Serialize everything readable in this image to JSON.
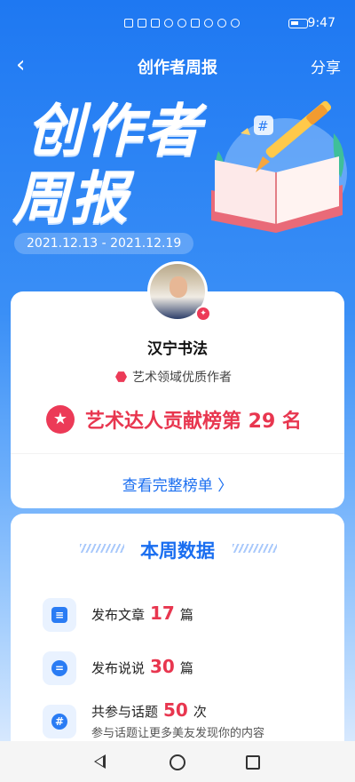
{
  "status": {
    "time": "9:47"
  },
  "nav": {
    "title": "创作者周报",
    "share": "分享",
    "back_glyph": "‹"
  },
  "hero": {
    "line1": "创作者",
    "line2": "周报",
    "date_range": "2021.12.13 - 2021.12.19"
  },
  "author": {
    "name": "汉宁书法",
    "quality_label": "艺术领域优质作者"
  },
  "rank": {
    "text": "艺术达人贡献榜第 29 名"
  },
  "full_list_link": "查看完整榜单 〉",
  "weekly": {
    "title": "本周数据",
    "stats": [
      {
        "prefix": "发布文章",
        "value": "17",
        "unit": "篇"
      },
      {
        "prefix": "发布说说",
        "value": "30",
        "unit": "篇"
      },
      {
        "prefix": "共参与话题",
        "value": "50",
        "unit": "次",
        "sub": "参与话题让更多美友发现你的内容"
      }
    ]
  },
  "colors": {
    "primary": "#1a6ef0",
    "accent": "#e8364f"
  },
  "icons": [
    "document-icon",
    "chat-bubble-icon",
    "hashtag-icon",
    "shield-star-icon",
    "star-icon"
  ]
}
